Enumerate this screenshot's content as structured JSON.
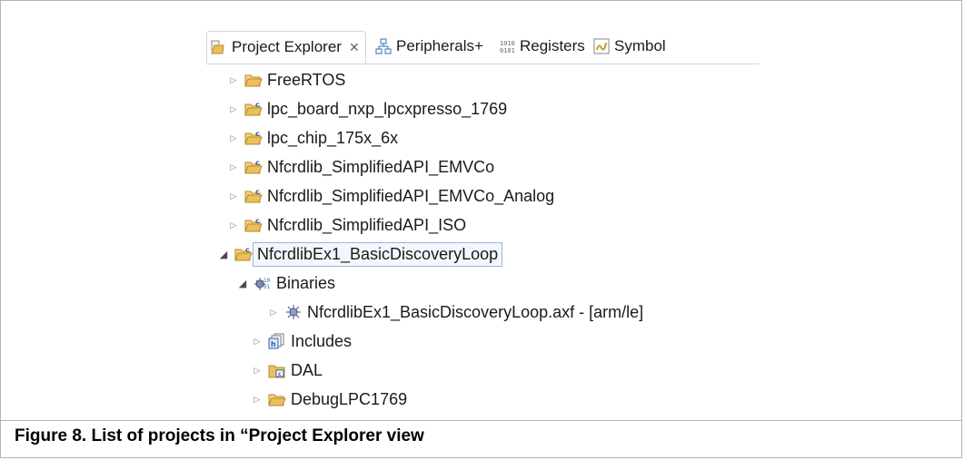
{
  "figure": {
    "caption": "Figure 8.  List of projects in “Project Explorer view"
  },
  "tabs": [
    {
      "label": "Project Explorer",
      "icon": "project-explorer-icon",
      "close": "✕",
      "active": true
    },
    {
      "label": "Peripherals+",
      "icon": "peripherals-icon",
      "active": false
    },
    {
      "label": "Registers",
      "icon": "registers-icon",
      "active": false
    },
    {
      "label": "Symbol",
      "icon": "symbol-viewer-icon",
      "active": false
    }
  ],
  "tree": [
    {
      "label": "FreeRTOS",
      "icon": "folder-open-icon",
      "expanded": false,
      "level": 0
    },
    {
      "label": "lpc_board_nxp_lpcxpresso_1769",
      "icon": "c-project-folder-icon",
      "expanded": false,
      "level": 0
    },
    {
      "label": "lpc_chip_175x_6x",
      "icon": "c-project-folder-icon",
      "expanded": false,
      "level": 0
    },
    {
      "label": "Nfcrdlib_SimplifiedAPI_EMVCo",
      "icon": "c-project-folder-icon",
      "expanded": false,
      "level": 0
    },
    {
      "label": "Nfcrdlib_SimplifiedAPI_EMVCo_Analog",
      "icon": "c-project-folder-icon",
      "expanded": false,
      "level": 0
    },
    {
      "label": "Nfcrdlib_SimplifiedAPI_ISO",
      "icon": "c-project-folder-icon",
      "expanded": false,
      "level": 0
    },
    {
      "label": "NfcrdlibEx1_BasicDiscoveryLoop",
      "icon": "c-project-folder-icon",
      "expanded": true,
      "level": 0,
      "selected": true
    },
    {
      "label": "Binaries",
      "icon": "binaries-icon",
      "expanded": true,
      "level": 1
    },
    {
      "label": "NfcrdlibEx1_BasicDiscoveryLoop.axf - [arm/le]",
      "icon": "binary-file-icon",
      "expanded": false,
      "level": 2
    },
    {
      "label": "Includes",
      "icon": "includes-icon",
      "expanded": false,
      "level": 1
    },
    {
      "label": "DAL",
      "icon": "source-folder-icon",
      "expanded": false,
      "level": 1
    },
    {
      "label": "DebugLPC1769",
      "icon": "folder-icon",
      "expanded": false,
      "level": 1
    }
  ],
  "colors": {
    "folder": "#e9c05a",
    "folder_edge": "#b8892a",
    "selection_border": "#9cb6d8",
    "tab_border": "#c8d7ea"
  }
}
